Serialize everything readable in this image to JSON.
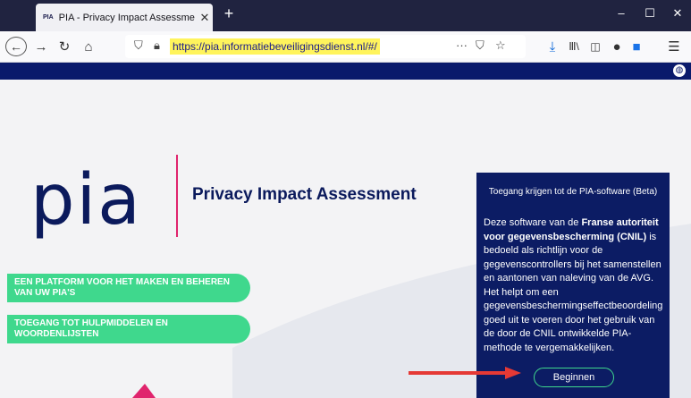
{
  "browser": {
    "tab_title": "PIA - Privacy Impact Assessme",
    "tab_favicon": "PIA",
    "url": "https://pia.informatiebeveiligingsdienst.nl/#/"
  },
  "hero": {
    "logo_text": "pia",
    "subtitle": "Privacy Impact Assessment",
    "pill_1": "EEN PLATFORM VOOR HET MAKEN EN BEHEREN VAN UW PIA'S",
    "pill_2": "TOEGANG TOT HULPMIDDELEN EN WOORDENLIJSTEN"
  },
  "panel": {
    "title": "Toegang krijgen tot de PIA-software (Beta)",
    "body_intro": "Deze software van de ",
    "body_bold": "Franse autoriteit voor gegevensbescherming (CNIL)",
    "body_rest": " is bedoeld als richtlijn voor de gegevenscontrollers bij het samenstellen en aantonen van naleving van de AVG. Het helpt om een gegevensbeschermingseffectbeoordeling goed uit te voeren door het gebruik van de door de CNIL ontwikkelde PIA-methode te vergemakkelijken.",
    "button": "Beginnen"
  },
  "colors": {
    "brand": "#0b1a5c",
    "accent": "#e0246d",
    "green": "#3fd88d",
    "panel": "#0c1c64"
  }
}
